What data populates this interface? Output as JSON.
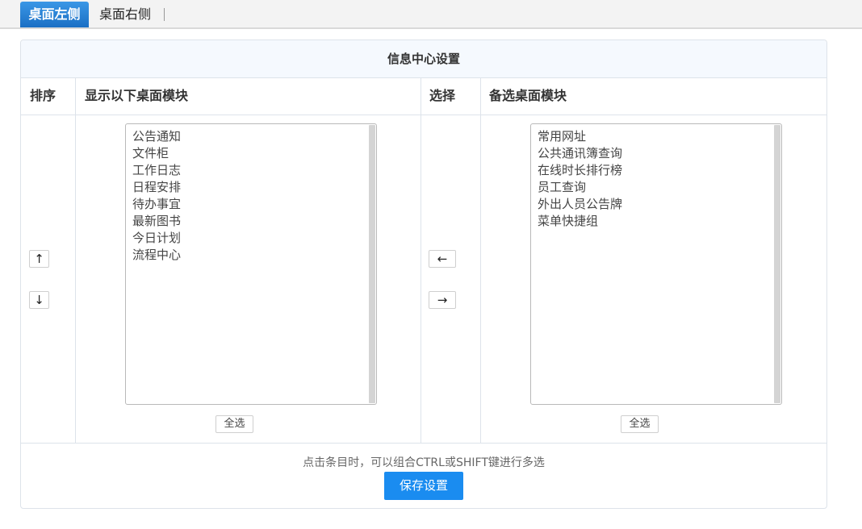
{
  "tabs": [
    {
      "label": "桌面左侧",
      "active": true
    },
    {
      "label": "桌面右侧",
      "active": false
    }
  ],
  "panel": {
    "title": "信息中心设置",
    "headers": {
      "sort": "排序",
      "shown": "显示以下桌面模块",
      "select": "选择",
      "available": "备选桌面模块"
    },
    "shown_modules": [
      "公告通知",
      "文件柜",
      "工作日志",
      "日程安排",
      "待办事宜",
      "最新图书",
      "今日计划",
      "流程中心"
    ],
    "available_modules": [
      "常用网址",
      "公共通讯簿查询",
      "在线时长排行榜",
      "员工查询",
      "外出人员公告牌",
      "菜单快捷组"
    ],
    "select_all_label": "全选",
    "up_arrow": "↑",
    "down_arrow": "↓",
    "left_arrow": "←",
    "right_arrow": "→",
    "hint": "点击条目时，可以组合CTRL或SHIFT键进行多选",
    "save_label": "保存设置"
  },
  "colors": {
    "active_tab": "#2b84d9",
    "save_button": "#1a8cf0",
    "header_bg": "#f5f9fe",
    "border": "#dde3ea"
  }
}
